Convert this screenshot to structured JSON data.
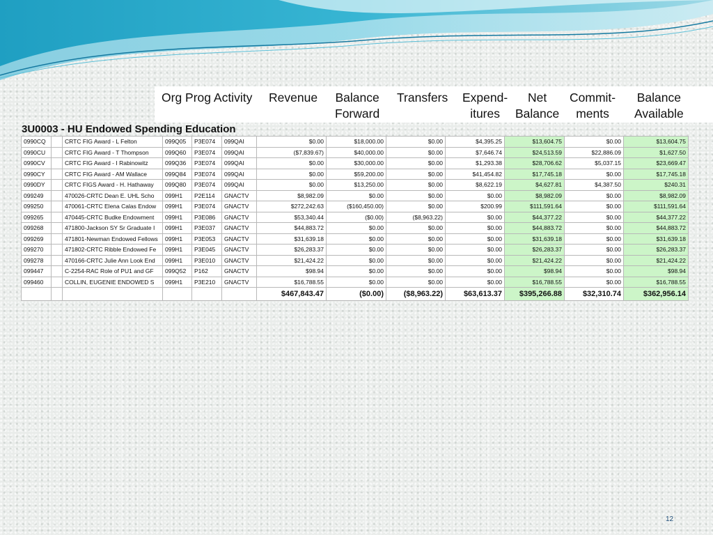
{
  "colors": {
    "net_balance_fill": "#ccf5c8",
    "balance_available_fill": "#ccf5c8",
    "wave_teal": "#2aa7c5",
    "wave_light": "#a8dbe8"
  },
  "header": {
    "org_prog_activity": "Org Prog Activity",
    "revenue": "Revenue",
    "balance_forward": [
      "Balance",
      "Forward"
    ],
    "transfers": "Transfers",
    "expenditures": [
      "Expend-",
      "itures"
    ],
    "net_balance": [
      "Net",
      "Balance"
    ],
    "commitments": [
      "Commit-",
      "ments"
    ],
    "balance_available": [
      "Balance",
      "Available"
    ]
  },
  "table_title": "3U0003 - HU Endowed Spending Education",
  "rows": [
    [
      "0990CQ",
      "CRTC FIG Award - L Felton",
      "099Q05",
      "P3E074",
      "099QAI",
      "$0.00",
      "$18,000.00",
      "$0.00",
      "$4,395.25",
      "$13,604.75",
      "$0.00",
      "$13,604.75"
    ],
    [
      "0990CU",
      "CRTC FIG Award - T Thompson",
      "099Q60",
      "P3E074",
      "099QAI",
      "($7,839.67)",
      "$40,000.00",
      "$0.00",
      "$7,646.74",
      "$24,513.59",
      "$22,886.09",
      "$1,627.50"
    ],
    [
      "0990CV",
      "CRTC FIG Award - I Rabinowitz",
      "099Q36",
      "P3E074",
      "099QAI",
      "$0.00",
      "$30,000.00",
      "$0.00",
      "$1,293.38",
      "$28,706.62",
      "$5,037.15",
      "$23,669.47"
    ],
    [
      "0990CY",
      "CRTC FIG Award - AM Wallace",
      "099Q84",
      "P3E074",
      "099QAI",
      "$0.00",
      "$59,200.00",
      "$0.00",
      "$41,454.82",
      "$17,745.18",
      "$0.00",
      "$17,745.18"
    ],
    [
      "0990DY",
      "CRTC FIGS Award - H. Hathaway",
      "099Q80",
      "P3E074",
      "099QAI",
      "$0.00",
      "$13,250.00",
      "$0.00",
      "$8,622.19",
      "$4,627.81",
      "$4,387.50",
      "$240.31"
    ],
    [
      "099249",
      "470026-CRTC Dean E. UHL Scho",
      "099H1",
      "P2E114",
      "GNACTV",
      "$8,982.09",
      "$0.00",
      "$0.00",
      "$0.00",
      "$8,982.09",
      "$0.00",
      "$8,982.09"
    ],
    [
      "099250",
      "470061-CRTC Elena Calas Endow",
      "099H1",
      "P3E074",
      "GNACTV",
      "$272,242.63",
      "($160,450.00)",
      "$0.00",
      "$200.99",
      "$111,591.64",
      "$0.00",
      "$111,591.64"
    ],
    [
      "099265",
      "470445-CRTC Budke Endowment",
      "099H1",
      "P3E086",
      "GNACTV",
      "$53,340.44",
      "($0.00)",
      "($8,963.22)",
      "$0.00",
      "$44,377.22",
      "$0.00",
      "$44,377.22"
    ],
    [
      "099268",
      "471800-Jackson SY Sr Graduate I",
      "099H1",
      "P3E037",
      "GNACTV",
      "$44,883.72",
      "$0.00",
      "$0.00",
      "$0.00",
      "$44,883.72",
      "$0.00",
      "$44,883.72"
    ],
    [
      "099269",
      "471801-Newman Endowed Fellows",
      "099H1",
      "P3E053",
      "GNACTV",
      "$31,639.18",
      "$0.00",
      "$0.00",
      "$0.00",
      "$31,639.18",
      "$0.00",
      "$31,639.18"
    ],
    [
      "099270",
      "471802-CRTC Ribble Endowed Fe",
      "099H1",
      "P3E045",
      "GNACTV",
      "$26,283.37",
      "$0.00",
      "$0.00",
      "$0.00",
      "$26,283.37",
      "$0.00",
      "$26,283.37"
    ],
    [
      "099278",
      "470166-CRTC Julie Ann Look End",
      "099H1",
      "P3E010",
      "GNACTV",
      "$21,424.22",
      "$0.00",
      "$0.00",
      "$0.00",
      "$21,424.22",
      "$0.00",
      "$21,424.22"
    ],
    [
      "099447",
      "C-2254-RAC Role of PU1 and GF",
      "099Q52",
      "P162",
      "GNACTV",
      "$98.94",
      "$0.00",
      "$0.00",
      "$0.00",
      "$98.94",
      "$0.00",
      "$98.94"
    ],
    [
      "099460",
      "COLLIN, EUGENIE ENDOWED S",
      "099H1",
      "P3E210",
      "GNACTV",
      "$16,788.55",
      "$0.00",
      "$0.00",
      "$0.00",
      "$16,788.55",
      "$0.00",
      "$16,788.55"
    ]
  ],
  "totals": [
    "$467,843.47",
    "($0.00)",
    "($8,963.22)",
    "$63,613.37",
    "$395,266.88",
    "$32,310.74",
    "$362,956.14"
  ],
  "page_number": "12"
}
